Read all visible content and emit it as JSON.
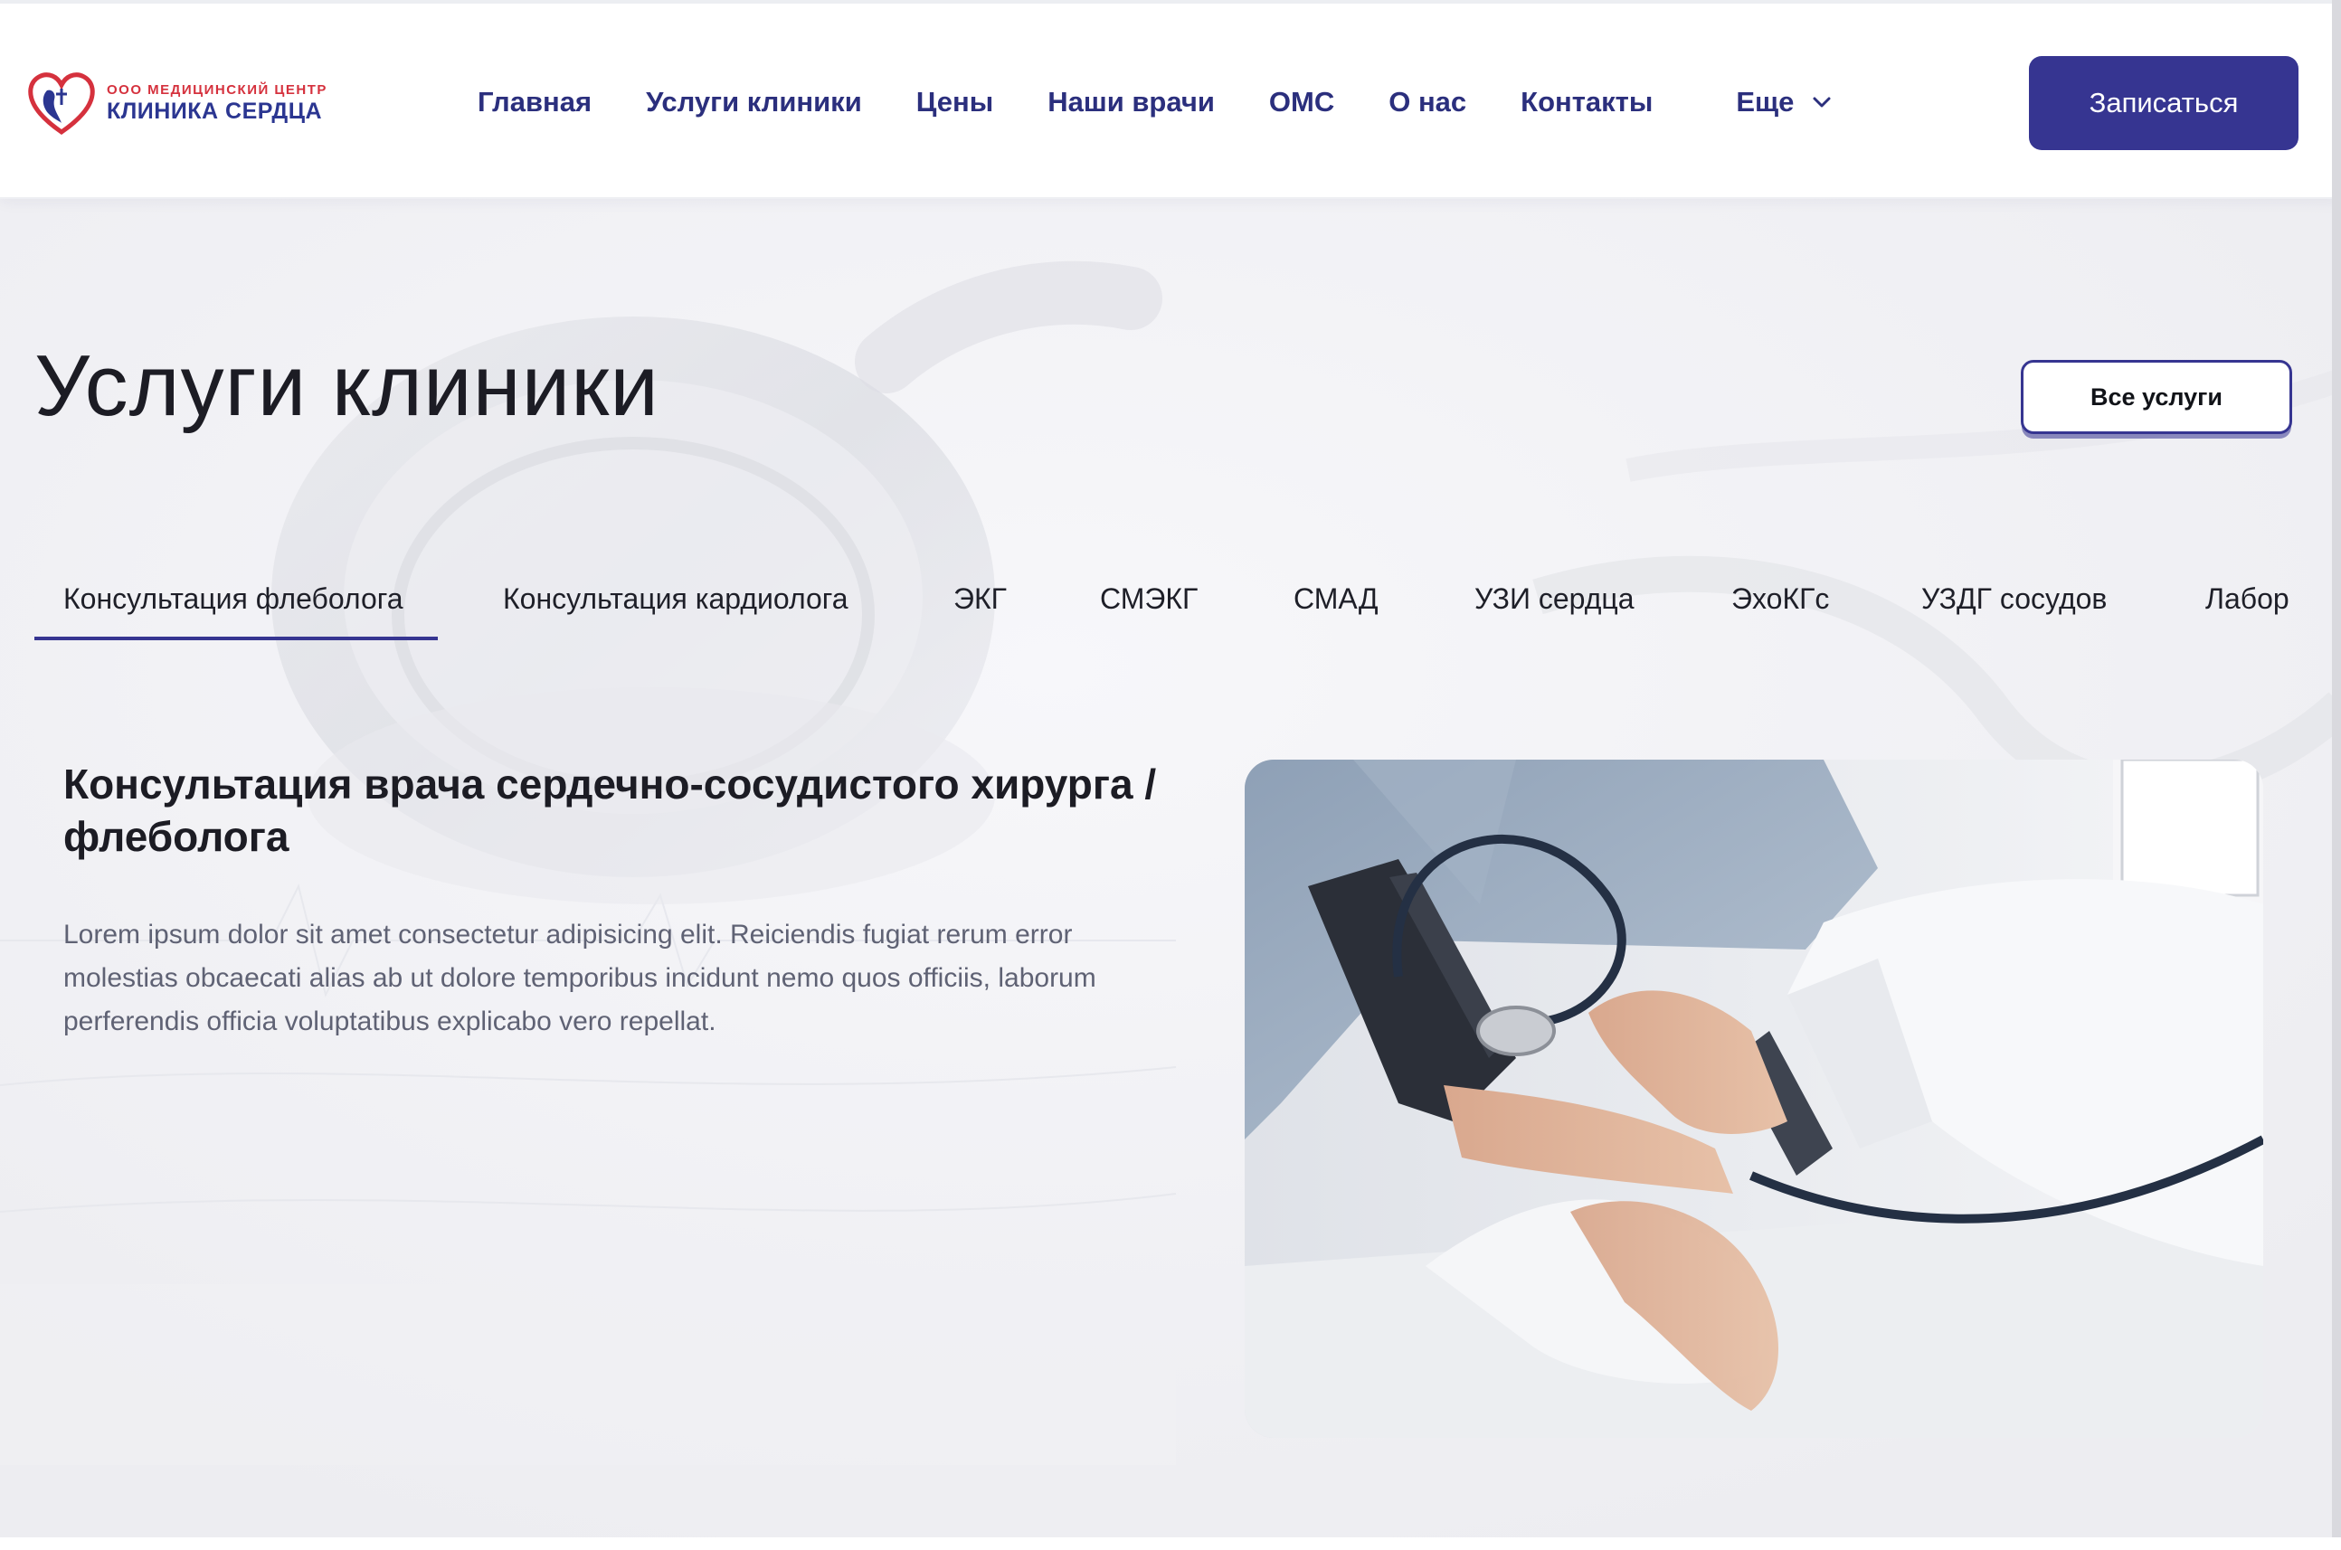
{
  "header": {
    "logo": {
      "subtitle": "ООО МЕДИЦИНСКИЙ ЦЕНТР",
      "title": "КЛИНИКА СЕРДЦА",
      "icon": "heart-logo-icon"
    },
    "nav": [
      {
        "label": "Главная"
      },
      {
        "label": "Услуги клиники"
      },
      {
        "label": "Цены"
      },
      {
        "label": "Наши врачи"
      },
      {
        "label": "ОМС"
      },
      {
        "label": "О нас"
      },
      {
        "label": "Контакты"
      }
    ],
    "more": {
      "label": "Еще",
      "icon": "chevron-down-icon"
    },
    "cta_label": "Записаться"
  },
  "services": {
    "title": "Услуги клиники",
    "all_label": "Все услуги",
    "tabs": [
      {
        "label": "Консультация флеболога",
        "active": true
      },
      {
        "label": "Консультация кардиолога"
      },
      {
        "label": "ЭКГ"
      },
      {
        "label": "СМЭКГ"
      },
      {
        "label": "СМАД"
      },
      {
        "label": "УЗИ сердца"
      },
      {
        "label": "ЭхоКГс"
      },
      {
        "label": "УЗДГ сосудов"
      },
      {
        "label": "Лабор"
      }
    ],
    "detail": {
      "title": "Консультация врача сердечно-сосудистого хирурга / флеболога",
      "text": "Lorem ipsum dolor sit amet consectetur adipisicing elit. Reiciendis fugiat rerum error molestias obcaecati alias ab ut dolore temporibus incidunt nemo quos officiis, laborum perferendis officia voluptatibus explicabo vero repellat."
    }
  },
  "colors": {
    "brand": "#363591",
    "nav_text": "#2b2f7d",
    "logo_red": "#d5313d",
    "page_bg": "#f4f4f7"
  }
}
